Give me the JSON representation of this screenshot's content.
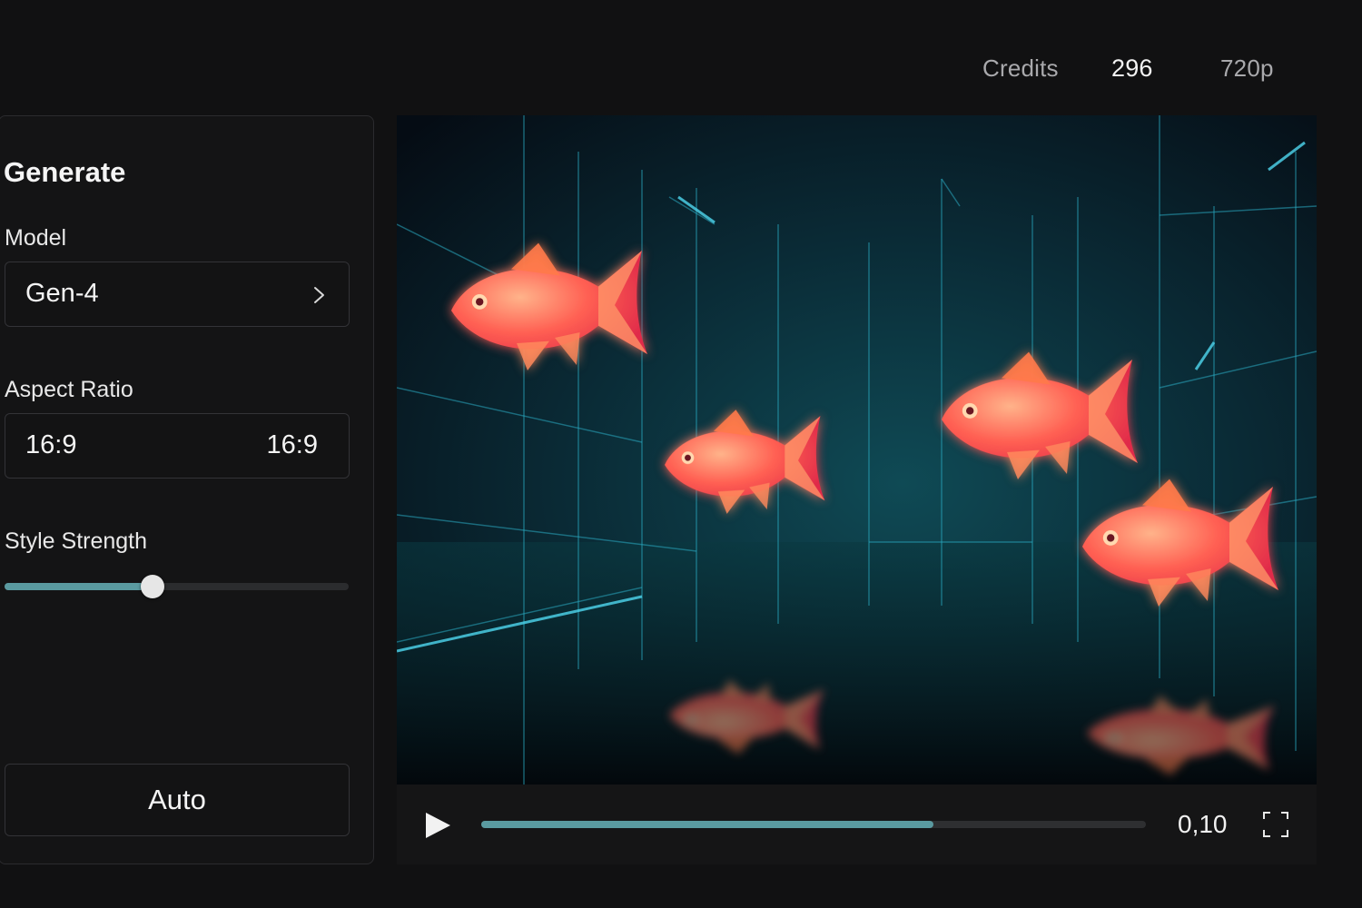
{
  "header": {
    "credits_label": "Credits",
    "credits_value": "296",
    "resolution": "720p"
  },
  "panel": {
    "title": "Generate",
    "model": {
      "label": "Model",
      "value": "Gen-4",
      "icon": "chevron-right-icon"
    },
    "aspect_ratio": {
      "label": "Aspect Ratio",
      "value_left": "16:9",
      "value_right": "16:9"
    },
    "style_strength": {
      "label": "Style Strength",
      "value_fraction": 0.43
    },
    "auto_button": "Auto"
  },
  "player": {
    "progress_fraction": 0.68,
    "timecode": "0,10",
    "icons": [
      "play-icon",
      "fullscreen-icon"
    ],
    "accent_color": "#5a9aa0"
  }
}
